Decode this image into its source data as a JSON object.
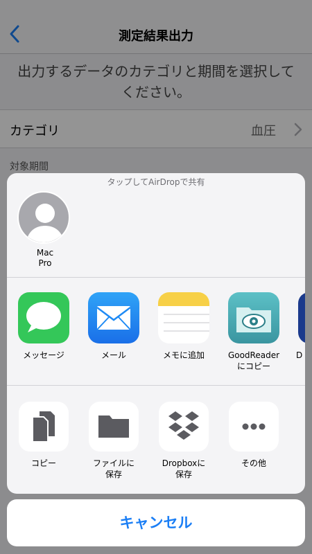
{
  "background_page": {
    "title": "測定結果出力",
    "instruction": "出力するデータのカテゴリと期間を選択してください。",
    "category_label": "カテゴリ",
    "category_value": "血圧",
    "period_label": "対象期間"
  },
  "share_sheet": {
    "airdrop_caption": "タップしてAirDropで共有",
    "airdrop_device": {
      "name": "Mac\nPro",
      "icon": "person-silhouette-icon"
    },
    "apps": [
      {
        "label": "メッセージ",
        "icon": "messages-icon",
        "color": "#34c759"
      },
      {
        "label": "メール",
        "icon": "mail-icon",
        "color": "#1e8af5"
      },
      {
        "label": "メモに追加",
        "icon": "notes-icon",
        "color": "#f7d047"
      },
      {
        "label": "GoodReader\nにコピー",
        "icon": "goodreader-icon",
        "color": "#4aa8b0"
      },
      {
        "label": "D",
        "icon": "partial-app-icon",
        "color": "#1b3a8c"
      }
    ],
    "actions": [
      {
        "label": "コピー",
        "icon": "copy-icon"
      },
      {
        "label": "ファイルに\n保存",
        "icon": "folder-icon"
      },
      {
        "label": "Dropboxに\n保存",
        "icon": "dropbox-icon"
      },
      {
        "label": "その他",
        "icon": "more-icon"
      }
    ],
    "cancel_label": "キャンセル"
  },
  "colors": {
    "accent": "#1a7ef5",
    "icon_gray": "#5b5b60"
  }
}
